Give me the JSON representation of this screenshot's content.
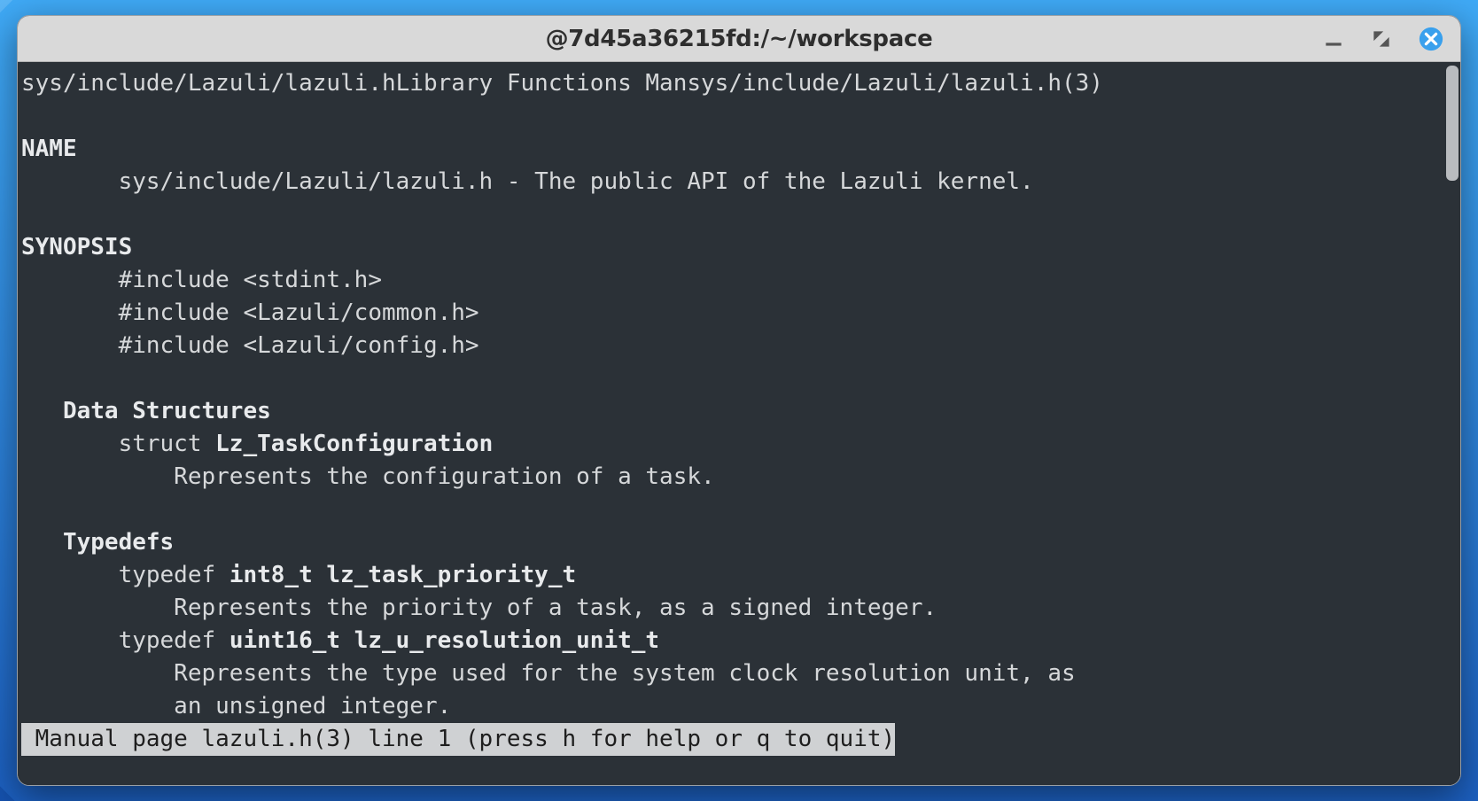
{
  "window": {
    "title": "@7d45a36215fd:/~/workspace"
  },
  "man": {
    "header": "sys/include/Lazuli/lazuli.hLibrary Functions Mansys/include/Lazuli/lazuli.h(3)",
    "name_hdr": "NAME",
    "name_body": "       sys/include/Lazuli/lazuli.h - The public API of the Lazuli kernel.",
    "syn_hdr": "SYNOPSIS",
    "inc1": "       #include <stdint.h>",
    "inc2": "       #include <Lazuli/common.h>",
    "inc3": "       #include <Lazuli/config.h>",
    "ds_hdr": "   Data Structures",
    "ds1_pre": "       struct ",
    "ds1_b": "Lz_TaskConfiguration",
    "ds1_desc": "           Represents the configuration of a task.",
    "td_hdr": "   Typedefs",
    "td1_pre": "       typedef ",
    "td1_b": "int8_t lz_task_priority_t",
    "td1_desc": "           Represents the priority of a task, as a signed integer.",
    "td2_pre": "       typedef ",
    "td2_b": "uint16_t lz_u_resolution_unit_t",
    "td2_desc1": "           Represents the type used for the system clock resolution unit, as",
    "td2_desc2": "           an unsigned integer.",
    "status": " Manual page lazuli.h(3) line 1 (press h for help or q to quit)"
  }
}
